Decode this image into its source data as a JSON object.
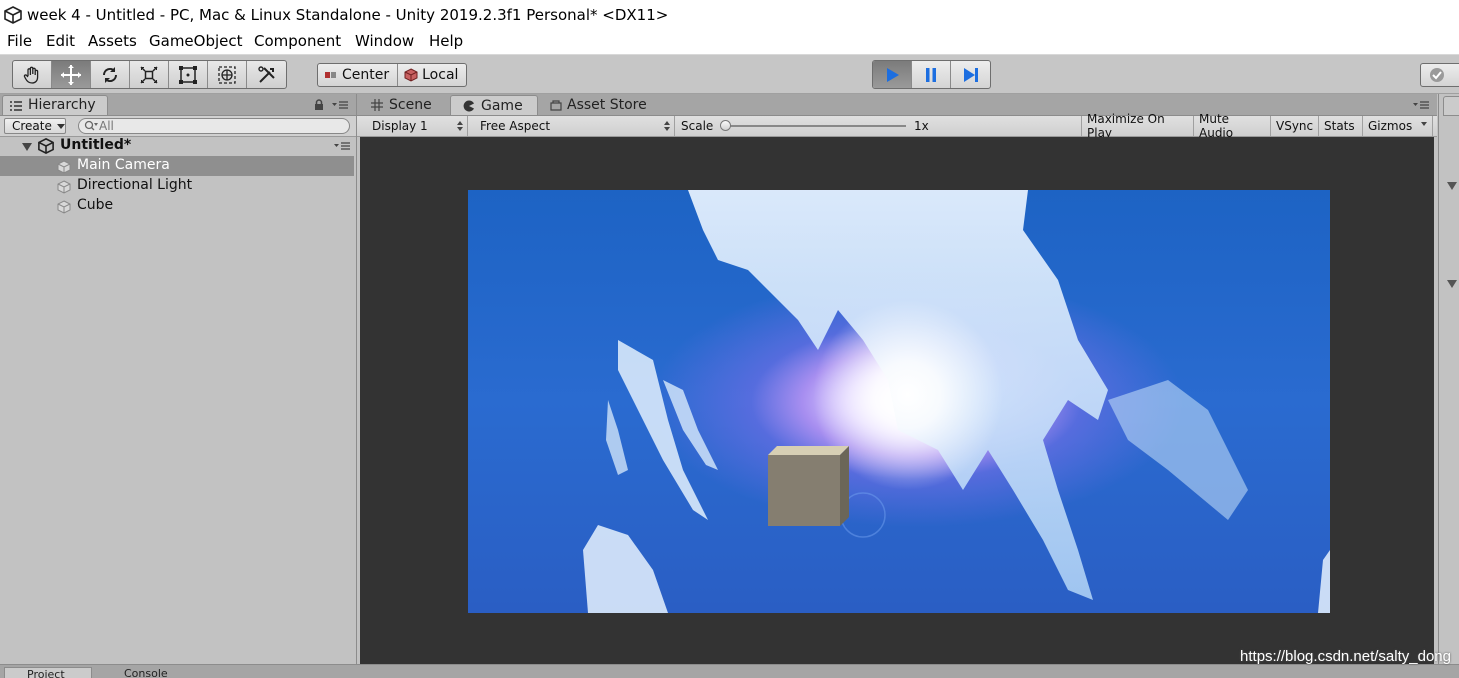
{
  "window": {
    "title": "week 4 - Untitled - PC, Mac & Linux Standalone - Unity 2019.2.3f1 Personal* <DX11>"
  },
  "menu": {
    "items": [
      "File",
      "Edit",
      "Assets",
      "GameObject",
      "Component",
      "Window",
      "Help"
    ]
  },
  "toolbar": {
    "tools": [
      "hand-tool",
      "move-tool",
      "rotate-tool",
      "scale-tool",
      "rect-tool",
      "transform-tool",
      "custom-tool"
    ],
    "active_tool": "move-tool",
    "pivot_mode": "Center",
    "pivot_rotation": "Local",
    "play_state": "playing"
  },
  "hierarchy": {
    "tab_label": "Hierarchy",
    "create_label": "Create",
    "search_placeholder": "All",
    "scene_name": "Untitled*",
    "items": [
      {
        "label": "Main Camera",
        "selected": true
      },
      {
        "label": "Directional Light",
        "selected": false
      },
      {
        "label": "Cube",
        "selected": false
      }
    ]
  },
  "gameview": {
    "tabs": [
      {
        "label": "Scene",
        "icon": "grid-icon"
      },
      {
        "label": "Game",
        "icon": "pacman-icon",
        "active": true
      },
      {
        "label": "Asset Store",
        "icon": "store-icon"
      }
    ],
    "display": "Display 1",
    "aspect": "Free Aspect",
    "scale_label": "Scale",
    "scale_value": "1x",
    "toggles": [
      "Maximize On Play",
      "Mute Audio",
      "VSync",
      "Stats",
      "Gizmos"
    ]
  },
  "bottom": {
    "tabs": [
      "Project",
      "Console"
    ]
  },
  "watermark": "https://blog.csdn.net/salty_dong"
}
